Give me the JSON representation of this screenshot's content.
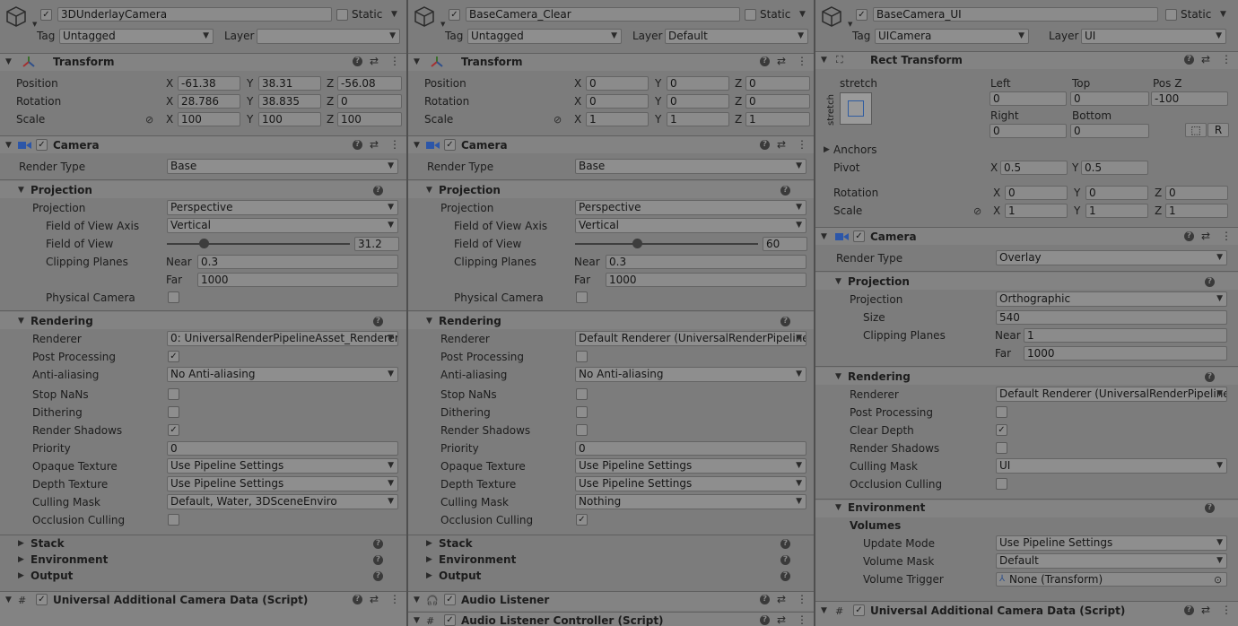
{
  "panels": [
    {
      "object": {
        "name": "3DUnderlayCamera",
        "static_label": "Static",
        "tag_label": "Tag",
        "tag_value": "Untagged",
        "layer_label": "Layer",
        "layer_value": ""
      },
      "transform": {
        "title": "Transform",
        "rows": [
          {
            "label": "Position",
            "x": "-61.38",
            "y": "38.31",
            "z": "-56.08"
          },
          {
            "label": "Rotation",
            "x": "28.786",
            "y": "38.835",
            "z": "0"
          },
          {
            "label": "Scale",
            "x": "100",
            "y": "100",
            "z": "100"
          }
        ]
      },
      "camera": {
        "title": "Camera",
        "render_type_label": "Render Type",
        "render_type": "Base",
        "projection_section": "Projection",
        "projection_label": "Projection",
        "projection": "Perspective",
        "fov_axis_label": "Field of View Axis",
        "fov_axis": "Vertical",
        "fov_label": "Field of View",
        "fov": "31.2",
        "fov_fraction": 0.2,
        "clip_label": "Clipping Planes",
        "near_label": "Near",
        "near": "0.3",
        "far_label": "Far",
        "far": "1000",
        "physical_label": "Physical Camera",
        "rendering_section": "Rendering",
        "rendering_rows": [
          {
            "label": "Renderer",
            "type": "dropdown",
            "value": "0: UniversalRenderPipelineAsset_Renderer"
          },
          {
            "label": "Post Processing",
            "type": "check",
            "value": "✓"
          },
          {
            "label": "Anti-aliasing",
            "type": "dropdown",
            "value": "No Anti-aliasing"
          },
          {
            "label": "Stop NaNs",
            "type": "check",
            "value": ""
          },
          {
            "label": "Dithering",
            "type": "check",
            "value": ""
          },
          {
            "label": "Render Shadows",
            "type": "check",
            "value": "✓"
          },
          {
            "label": "Priority",
            "type": "field",
            "value": "0"
          },
          {
            "label": "Opaque Texture",
            "type": "dropdown",
            "value": "Use Pipeline Settings"
          },
          {
            "label": "Depth Texture",
            "type": "dropdown",
            "value": "Use Pipeline Settings"
          },
          {
            "label": "Culling Mask",
            "type": "dropdown",
            "value": "Default, Water, 3DSceneEnviro"
          },
          {
            "label": "Occlusion Culling",
            "type": "check",
            "value": ""
          }
        ],
        "collapsed": [
          "Stack",
          "Environment",
          "Output"
        ]
      },
      "components": [
        {
          "icon": "#",
          "title": "Universal Additional Camera Data (Script)"
        }
      ]
    },
    {
      "object": {
        "name": "BaseCamera_Clear",
        "static_label": "Static",
        "tag_label": "Tag",
        "tag_value": "Untagged",
        "layer_label": "Layer",
        "layer_value": "Default"
      },
      "transform": {
        "title": "Transform",
        "rows": [
          {
            "label": "Position",
            "x": "0",
            "y": "0",
            "z": "0"
          },
          {
            "label": "Rotation",
            "x": "0",
            "y": "0",
            "z": "0"
          },
          {
            "label": "Scale",
            "x": "1",
            "y": "1",
            "z": "1"
          }
        ]
      },
      "camera": {
        "title": "Camera",
        "render_type_label": "Render Type",
        "render_type": "Base",
        "projection_section": "Projection",
        "projection_label": "Projection",
        "projection": "Perspective",
        "fov_axis_label": "Field of View Axis",
        "fov_axis": "Vertical",
        "fov_label": "Field of View",
        "fov": "60",
        "fov_fraction": 0.34,
        "clip_label": "Clipping Planes",
        "near_label": "Near",
        "near": "0.3",
        "far_label": "Far",
        "far": "1000",
        "physical_label": "Physical Camera",
        "rendering_section": "Rendering",
        "rendering_rows": [
          {
            "label": "Renderer",
            "type": "dropdown",
            "value": "Default Renderer (UniversalRenderPipeline"
          },
          {
            "label": "Post Processing",
            "type": "check",
            "value": ""
          },
          {
            "label": "Anti-aliasing",
            "type": "dropdown",
            "value": "No Anti-aliasing"
          },
          {
            "label": "Stop NaNs",
            "type": "check",
            "value": ""
          },
          {
            "label": "Dithering",
            "type": "check",
            "value": ""
          },
          {
            "label": "Render Shadows",
            "type": "check",
            "value": ""
          },
          {
            "label": "Priority",
            "type": "field",
            "value": "0"
          },
          {
            "label": "Opaque Texture",
            "type": "dropdown",
            "value": "Use Pipeline Settings"
          },
          {
            "label": "Depth Texture",
            "type": "dropdown",
            "value": "Use Pipeline Settings"
          },
          {
            "label": "Culling Mask",
            "type": "dropdown",
            "value": "Nothing"
          },
          {
            "label": "Occlusion Culling",
            "type": "check",
            "value": "✓"
          }
        ],
        "collapsed": [
          "Stack",
          "Environment",
          "Output"
        ]
      },
      "components": [
        {
          "icon": "🎧",
          "title": "Audio Listener"
        },
        {
          "icon": "#",
          "title": "Audio Listener Controller (Script)"
        }
      ]
    }
  ],
  "ui_panel": {
    "object": {
      "name": "BaseCamera_UI",
      "static_label": "Static",
      "tag_label": "Tag",
      "tag_value": "UICamera",
      "layer_label": "Layer",
      "layer_value": "UI"
    },
    "rect": {
      "title": "Rect Transform",
      "stretch_top": "stretch",
      "stretch_side": "stretch",
      "left_label": "Left",
      "left": "0",
      "top_label": "Top",
      "top": "0",
      "posz_label": "Pos Z",
      "posz": "-100",
      "right_label": "Right",
      "right": "0",
      "bottom_label": "Bottom",
      "bottom": "0",
      "r_button": "R",
      "anchors_label": "Anchors",
      "pivot_label": "Pivot",
      "pivot_x": "0.5",
      "pivot_y": "0.5",
      "rotation_label": "Rotation",
      "rot_x": "0",
      "rot_y": "0",
      "rot_z": "0",
      "scale_label": "Scale",
      "scale_x": "1",
      "scale_y": "1",
      "scale_z": "1",
      "x": "X",
      "y": "Y",
      "z": "Z"
    },
    "camera": {
      "title": "Camera",
      "render_type_label": "Render Type",
      "render_type": "Overlay",
      "projection_section": "Projection",
      "projection_label": "Projection",
      "projection": "Orthographic",
      "size_label": "Size",
      "size": "540",
      "clip_label": "Clipping Planes",
      "near_label": "Near",
      "near": "1",
      "far_label": "Far",
      "far": "1000",
      "rendering_section": "Rendering",
      "rendering_rows": [
        {
          "label": "Renderer",
          "type": "dropdown",
          "value": "Default Renderer (UniversalRenderPipeline"
        },
        {
          "label": "Post Processing",
          "type": "check",
          "value": ""
        },
        {
          "label": "Clear Depth",
          "type": "check",
          "value": "✓"
        },
        {
          "label": "Render Shadows",
          "type": "check",
          "value": ""
        },
        {
          "label": "Culling Mask",
          "type": "dropdown",
          "value": "UI"
        },
        {
          "label": "Occlusion Culling",
          "type": "check",
          "value": ""
        }
      ],
      "environment_section": "Environment",
      "volumes_label": "Volumes",
      "update_mode_label": "Update Mode",
      "update_mode": "Use Pipeline Settings",
      "volume_mask_label": "Volume Mask",
      "volume_mask": "Default",
      "volume_trigger_label": "Volume Trigger",
      "volume_trigger": "None (Transform)"
    },
    "components": [
      {
        "icon": "#",
        "title": "Universal Additional Camera Data (Script)"
      }
    ]
  },
  "axis": {
    "x": "X",
    "y": "Y",
    "z": "Z"
  },
  "icons": {
    "help": "?",
    "preset": "⇄",
    "menu": "⋮",
    "check": "✓",
    "collapsed": "▶",
    "expanded": "▼",
    "dropdown": "▼"
  }
}
